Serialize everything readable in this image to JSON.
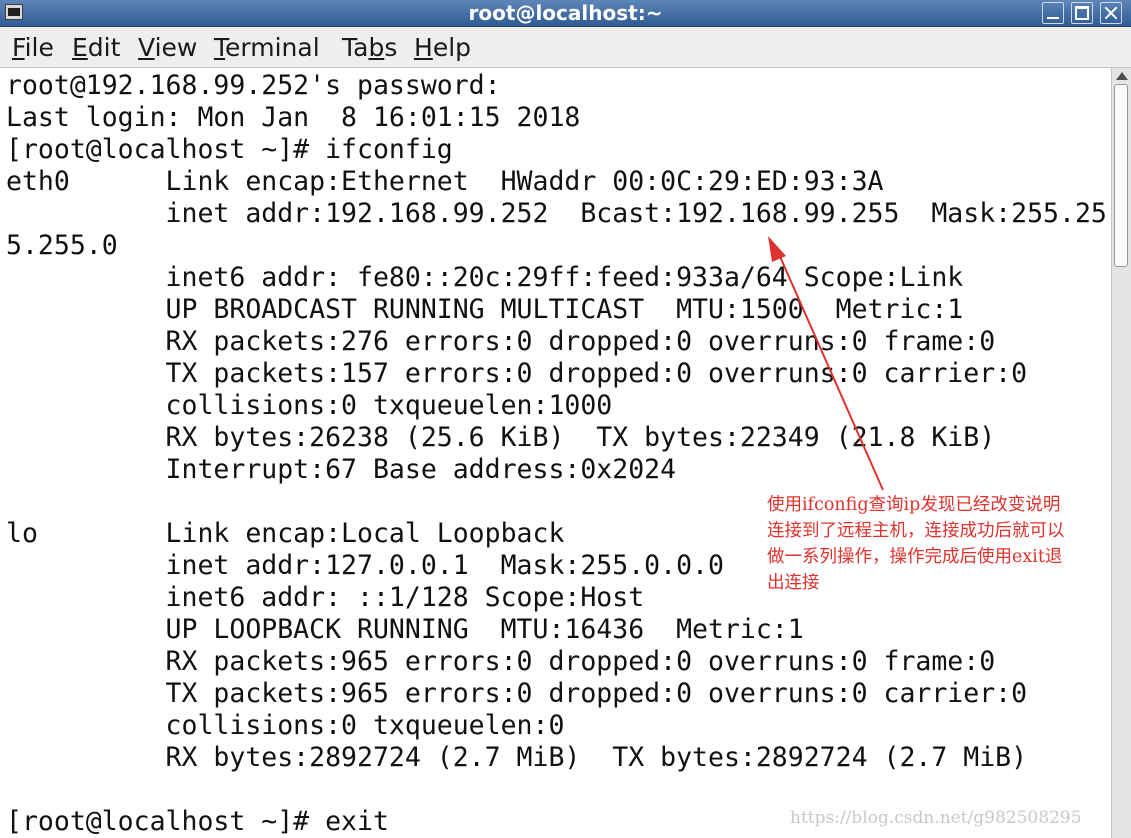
{
  "window": {
    "title": "root@localhost:~"
  },
  "menu": [
    {
      "mnemonic": "F",
      "rest": "ile"
    },
    {
      "mnemonic": "E",
      "rest": "dit"
    },
    {
      "mnemonic": "V",
      "rest": "iew"
    },
    {
      "mnemonic": "T",
      "rest": "erminal"
    },
    {
      "pre": "Ta",
      "mnemonic": "b",
      "rest": "s"
    },
    {
      "mnemonic": "H",
      "rest": "elp"
    }
  ],
  "terminal": {
    "lines": [
      "root@192.168.99.252's password:",
      "Last login: Mon Jan  8 16:01:15 2018",
      "[root@localhost ~]# ifconfig",
      "eth0      Link encap:Ethernet  HWaddr 00:0C:29:ED:93:3A",
      "          inet addr:192.168.99.252  Bcast:192.168.99.255  Mask:255.25",
      "5.255.0",
      "          inet6 addr: fe80::20c:29ff:feed:933a/64 Scope:Link",
      "          UP BROADCAST RUNNING MULTICAST  MTU:1500  Metric:1",
      "          RX packets:276 errors:0 dropped:0 overruns:0 frame:0",
      "          TX packets:157 errors:0 dropped:0 overruns:0 carrier:0",
      "          collisions:0 txqueuelen:1000",
      "          RX bytes:26238 (25.6 KiB)  TX bytes:22349 (21.8 KiB)",
      "          Interrupt:67 Base address:0x2024",
      "",
      "lo        Link encap:Local Loopback",
      "          inet addr:127.0.0.1  Mask:255.0.0.0",
      "          inet6 addr: ::1/128 Scope:Host",
      "          UP LOOPBACK RUNNING  MTU:16436  Metric:1",
      "          RX packets:965 errors:0 dropped:0 overruns:0 frame:0",
      "          TX packets:965 errors:0 dropped:0 overruns:0 carrier:0",
      "          collisions:0 txqueuelen:0",
      "          RX bytes:2892724 (2.7 MiB)  TX bytes:2892724 (2.7 MiB)",
      "",
      "[root@localhost ~]# exit"
    ]
  },
  "annotation": {
    "lines": [
      "使用ifconfig查询ip发现已经改变说明",
      "连接到了远程主机，连接成功后就可以",
      "做一系列操作，操作完成后使用exit退",
      "出连接"
    ],
    "color": "#e0322c"
  },
  "watermark": "https://blog.csdn.net/g982508295"
}
